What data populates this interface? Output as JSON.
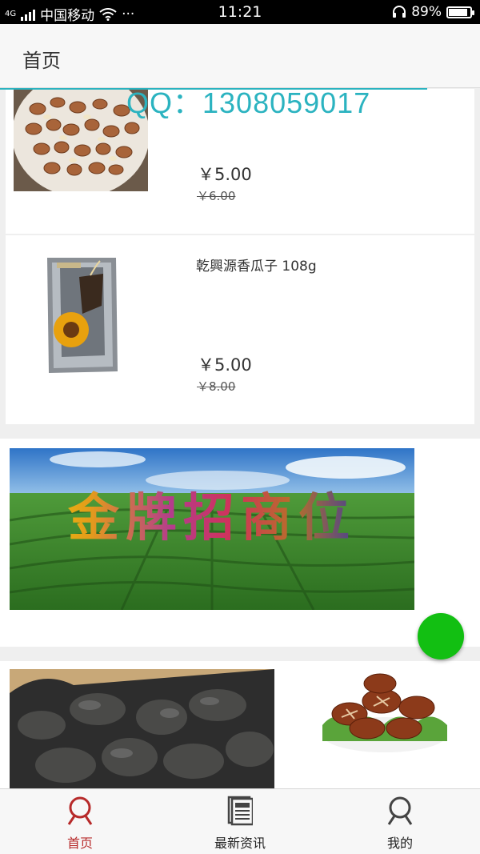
{
  "status_bar": {
    "carrier": "中国移动",
    "network_type": "4G",
    "time": "11:21",
    "battery": "89%",
    "battery_level": 0.89,
    "more": "···"
  },
  "header": {
    "title": "首页"
  },
  "watermark": "QQ：1308059017",
  "products": [
    {
      "name": "",
      "price": "￥5.00",
      "old_price": "￥6.00",
      "image": "pine-nuts-image"
    },
    {
      "name": "乾興源香瓜子 108g",
      "price": "￥5.00",
      "old_price": "￥8.00",
      "image": "sunflower-seeds-bag-image"
    }
  ],
  "banner": {
    "text": "金牌招商位"
  },
  "tabs": [
    {
      "label": "首页",
      "icon": "home-person-icon",
      "active": true
    },
    {
      "label": "最新资讯",
      "icon": "news-icon",
      "active": false
    },
    {
      "label": "我的",
      "icon": "profile-icon",
      "active": false
    }
  ],
  "colors": {
    "active_tab": "#b72a2a",
    "fab": "#12bf12",
    "watermark": "#2bb3c0"
  }
}
